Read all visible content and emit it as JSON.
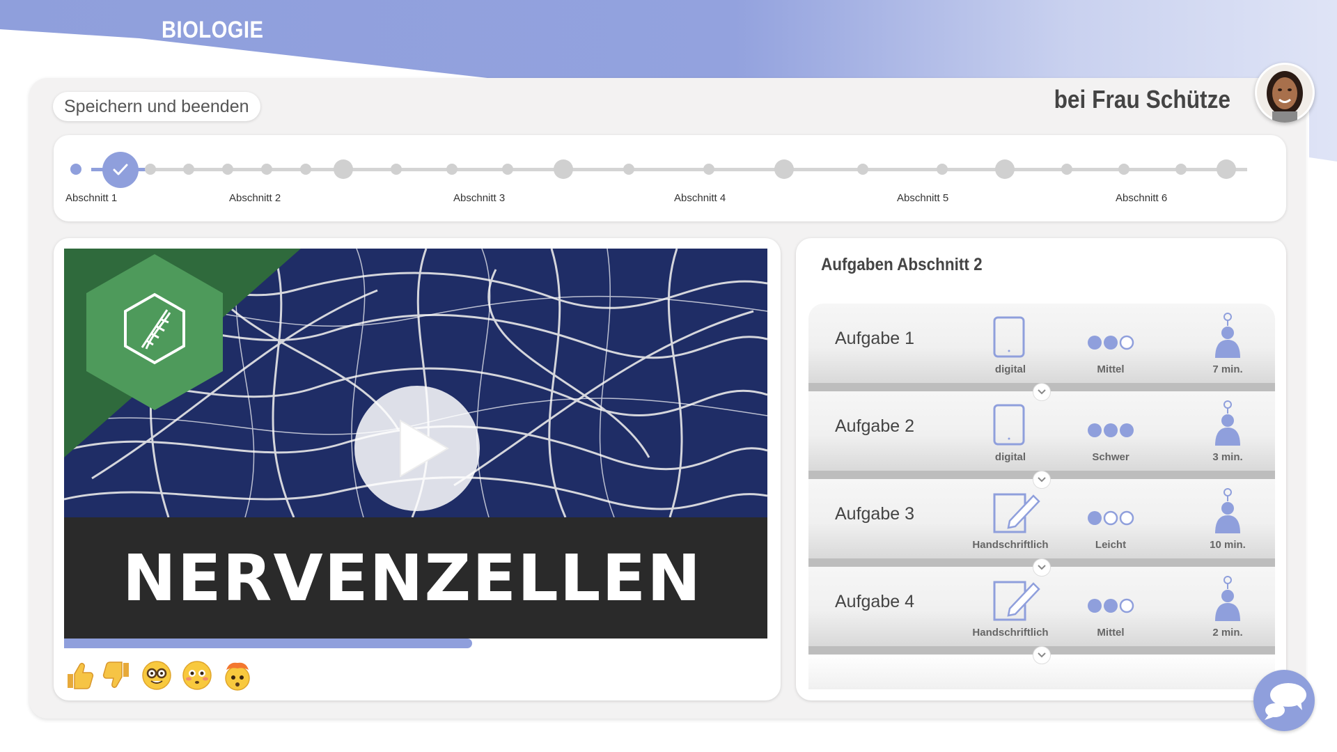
{
  "header": {
    "subject": "BIOLOGIE",
    "save_button": "Speichern und beenden",
    "teacher": "bei Frau Schütze"
  },
  "progress": {
    "current_section": 1,
    "sections": [
      "Abschnitt 1",
      "Abschnitt 2",
      "Abschnitt 3",
      "Abschnitt 4",
      "Abschnitt 5",
      "Abschnitt 6"
    ]
  },
  "video": {
    "title": "NERVENZELLEN",
    "progress_fraction": 0.58,
    "logo_icon": "dna-hexagon-icon",
    "reactions": [
      "thumbs-up",
      "thumbs-down",
      "nerd-face",
      "flushed-face",
      "exploding-head"
    ]
  },
  "tasks": {
    "heading": "Aufgaben Abschnitt 2",
    "items": [
      {
        "name": "Aufgabe 1",
        "mode": "digital",
        "mode_icon": "tablet-icon",
        "difficulty": "Mittel",
        "difficulty_level": 2,
        "duration": "7 min."
      },
      {
        "name": "Aufgabe 2",
        "mode": "digital",
        "mode_icon": "tablet-icon",
        "difficulty": "Schwer",
        "difficulty_level": 3,
        "duration": "3 min."
      },
      {
        "name": "Aufgabe 3",
        "mode": "Handschriftlich",
        "mode_icon": "pencil-paper-icon",
        "difficulty": "Leicht",
        "difficulty_level": 1,
        "duration": "10 min."
      },
      {
        "name": "Aufgabe 4",
        "mode": "Handschriftlich",
        "mode_icon": "pencil-paper-icon",
        "difficulty": "Mittel",
        "difficulty_level": 2,
        "duration": "2 min."
      }
    ]
  },
  "colors": {
    "accent": "#8f9fdc",
    "logo_green": "#4e9a5b",
    "logo_dark_green": "#2f6a3c",
    "video_bar": "#2a2a2a"
  }
}
